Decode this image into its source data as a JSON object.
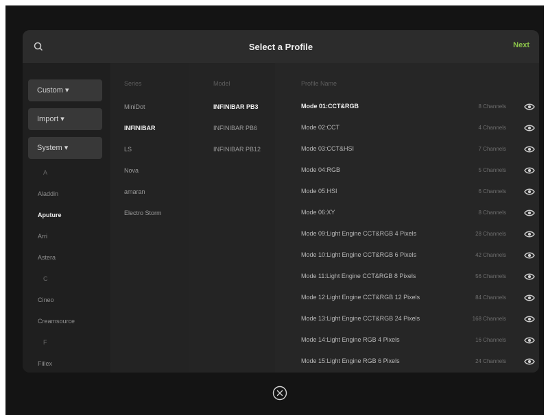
{
  "header": {
    "title": "Select a Profile",
    "next_label": "Next"
  },
  "filters": {
    "custom": "Custom ▾",
    "import": "Import ▾",
    "system": "System ▾"
  },
  "brands": [
    {
      "label": "A",
      "type": "letter"
    },
    {
      "label": "Aladdin",
      "type": "item"
    },
    {
      "label": "Aputure",
      "type": "item",
      "active": true
    },
    {
      "label": "Arri",
      "type": "item"
    },
    {
      "label": "Astera",
      "type": "item"
    },
    {
      "label": "C",
      "type": "letter"
    },
    {
      "label": "Cineo",
      "type": "item"
    },
    {
      "label": "Creamsource",
      "type": "item"
    },
    {
      "label": "F",
      "type": "letter"
    },
    {
      "label": "Fiilex",
      "type": "item"
    }
  ],
  "series": {
    "header": "Series",
    "items": [
      "MiniDot",
      "INFINIBAR",
      "LS",
      "Nova",
      "amaran",
      "Electro Storm"
    ],
    "active_index": 1
  },
  "model": {
    "header": "Model",
    "items": [
      "INFINIBAR PB3",
      "INFINIBAR PB6",
      "INFINIBAR PB12"
    ],
    "active_index": 0
  },
  "profiles": {
    "header": "Profile Name",
    "rows": [
      {
        "name": "Mode 01:CCT&RGB",
        "channels": "8 Channels",
        "active": true
      },
      {
        "name": "Mode 02:CCT",
        "channels": "4 Channels"
      },
      {
        "name": "Mode 03:CCT&HSI",
        "channels": "7 Channels"
      },
      {
        "name": "Mode 04:RGB",
        "channels": "5 Channels"
      },
      {
        "name": "Mode 05:HSI",
        "channels": "6 Channels"
      },
      {
        "name": "Mode 06:XY",
        "channels": "8 Channels"
      },
      {
        "name": "Mode 09:Light Engine CCT&RGB 4 Pixels",
        "channels": "28 Channels"
      },
      {
        "name": "Mode 10:Light Engine CCT&RGB 6 Pixels",
        "channels": "42 Channels"
      },
      {
        "name": "Mode 11:Light Engine CCT&RGB 8 Pixels",
        "channels": "56 Channels"
      },
      {
        "name": "Mode 12:Light Engine CCT&RGB 12 Pixels",
        "channels": "84 Channels"
      },
      {
        "name": "Mode 13:Light Engine CCT&RGB 24 Pixels",
        "channels": "168 Channels"
      },
      {
        "name": "Mode 14:Light Engine RGB 4 Pixels",
        "channels": "16 Channels"
      },
      {
        "name": "Mode 15:Light Engine RGB 6 Pixels",
        "channels": "24 Channels"
      }
    ]
  },
  "colors": {
    "accent": "#8bc34a",
    "modal_bg": "#242424",
    "header_bg": "#2c2c2c",
    "button_bg": "#383838"
  },
  "icons": {
    "search": "search-icon",
    "eye": "eye-icon",
    "close": "close-circle-icon"
  }
}
